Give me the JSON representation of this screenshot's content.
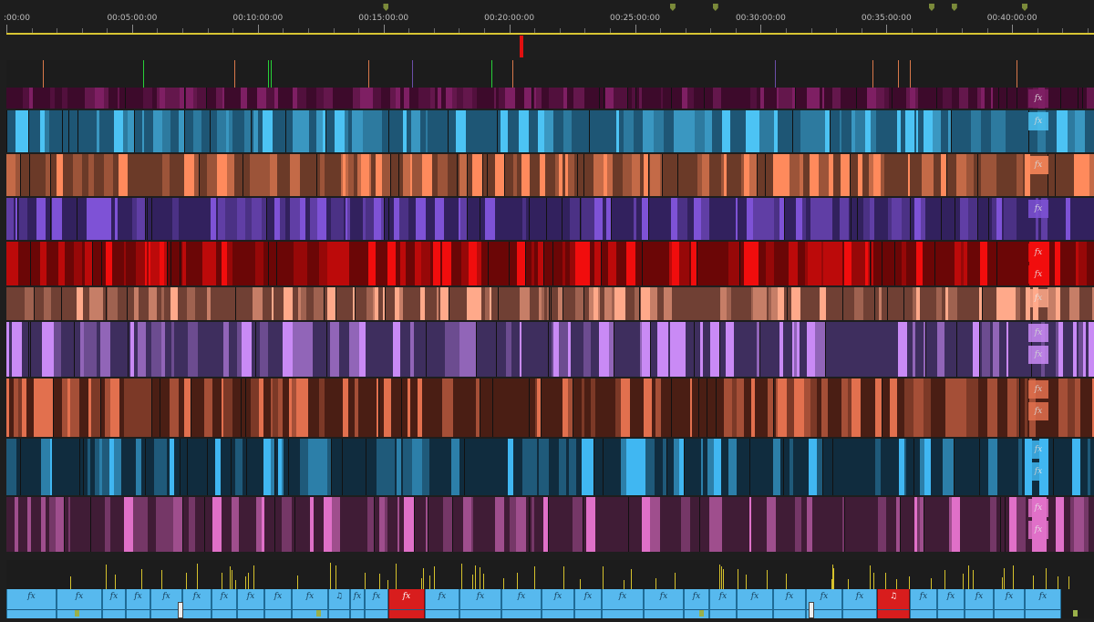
{
  "timeline": {
    "ruler": {
      "labels": [
        ":00:00",
        "00:05:00:00",
        "00:10:00:00",
        "00:15:00:00",
        "00:20:00:00",
        "00:25:00:00",
        "00:30:00:00",
        "00:35:00:00",
        "00:40:00:00"
      ]
    },
    "total_minutes": 43.5,
    "playhead_minutes": 20.5,
    "ruler_markers_minutes": [
      15.1,
      26.5,
      28.2,
      36.8,
      37.7,
      40.5
    ],
    "marker_lane_colors": {
      "orange": "#d8784a",
      "green": "#28d038",
      "purple": "#6c4ea8"
    },
    "track_colors": [
      {
        "name": "video-8",
        "base": "#3d0a2b",
        "hi": "#7e1f63"
      },
      {
        "name": "video-7",
        "base": "#1e5675",
        "hi": "#4cc3f4"
      },
      {
        "name": "video-6",
        "base": "#6b3a28",
        "hi": "#ff8a5c"
      },
      {
        "name": "video-5",
        "base": "#32215e",
        "hi": "#7e52d6"
      },
      {
        "name": "video-4",
        "base": "#6b0606",
        "hi": "#f10d0d"
      },
      {
        "name": "audio-1",
        "base": "#704034",
        "hi": "#ffa98a"
      },
      {
        "name": "audio-2",
        "base": "#3e2e5e",
        "hi": "#c98af5"
      },
      {
        "name": "audio-3",
        "base": "#4a1e14",
        "hi": "#e2704e"
      },
      {
        "name": "audio-4",
        "base": "#102c3e",
        "hi": "#40b7f2"
      },
      {
        "name": "audio-5",
        "base": "#401c36",
        "hi": "#e070c8"
      }
    ],
    "fx_label": "fx",
    "bottom_track": {
      "clip_color": "#57b9ee",
      "red_color": "#d81d1d",
      "clip_labels": [
        "fx",
        "fx",
        "fx",
        "fx",
        "fx",
        "fx",
        "fx",
        "fx",
        "fx",
        "fx",
        "♫",
        "fx",
        "fx",
        "fx",
        "fx",
        "fx",
        "fx",
        "fx",
        "fx",
        "fx",
        "fx",
        "fx",
        "fx",
        "fx",
        "fx",
        "fx",
        "fx",
        "♫",
        "fx",
        "fx",
        "fx",
        "fx",
        "fx"
      ]
    }
  }
}
